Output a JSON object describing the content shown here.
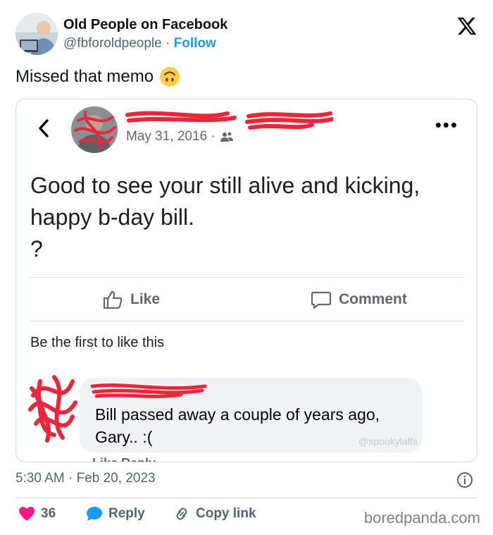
{
  "author": {
    "name": "Old People on Facebook",
    "handle": "@fbforoldpeople",
    "separator": "·",
    "follow_label": "Follow"
  },
  "tweet": {
    "text": "Missed that memo",
    "emoji": "upside-down-face"
  },
  "embed": {
    "post_date": "May 31, 2016 ·",
    "body_line1": "Good to see your still alive and kicking,",
    "body_line2": "happy b-day bill.",
    "body_line3": "?",
    "like_label": "Like",
    "comment_label": "Comment",
    "likes_note": "Be the first to like this",
    "comment_line1": "Bill passed away a couple of years ago,",
    "comment_line2": "Gary.. :(",
    "watermark": "@spookylaffs",
    "comment_actions": "Like   Reply"
  },
  "meta": {
    "timestamp": "5:30 AM · Feb 20, 2023"
  },
  "footer": {
    "likes_count": "36",
    "reply_label": "Reply",
    "copy_link_label": "Copy link",
    "brand": "boredpanda.com"
  },
  "colors": {
    "accent": "#1d9bf0",
    "heart": "#f91880",
    "redaction": "#e8273b",
    "muted": "#536471"
  }
}
